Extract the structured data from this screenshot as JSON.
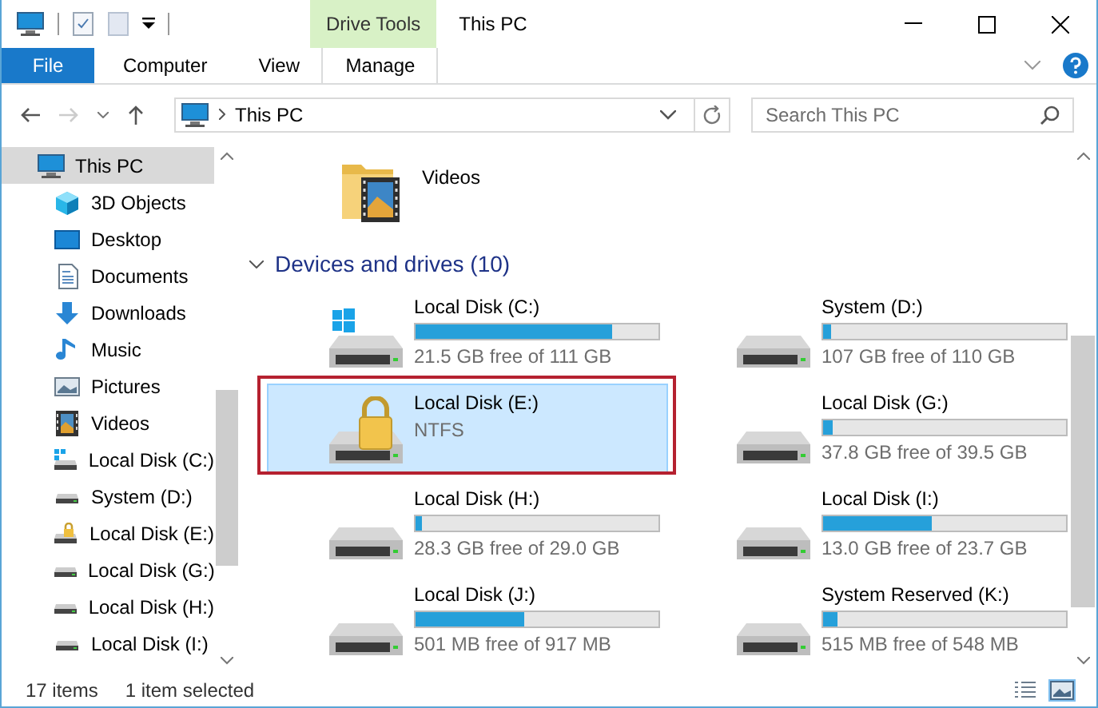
{
  "window": {
    "title": "This PC",
    "context_tab_group": "Drive Tools"
  },
  "ribbon": {
    "tabs": [
      {
        "label": "File",
        "kind": "file",
        "selected": false
      },
      {
        "label": "Computer",
        "kind": "normal",
        "selected": false
      },
      {
        "label": "View",
        "kind": "normal",
        "selected": false
      },
      {
        "label": "Manage",
        "kind": "context",
        "selected": false
      }
    ]
  },
  "address_bar": {
    "path": "This PC",
    "search": {
      "placeholder": "Search This PC"
    }
  },
  "sidebar": {
    "items": [
      {
        "label": "This PC",
        "kind": "pc",
        "selected": true,
        "children": [
          {
            "label": "3D Objects",
            "kind": "objects",
            "selected": false
          },
          {
            "label": "Desktop",
            "kind": "desktop",
            "selected": false
          },
          {
            "label": "Documents",
            "kind": "documents",
            "selected": false
          },
          {
            "label": "Downloads",
            "kind": "downloads",
            "selected": false
          },
          {
            "label": "Music",
            "kind": "music",
            "selected": false
          },
          {
            "label": "Pictures",
            "kind": "pictures",
            "selected": false
          },
          {
            "label": "Videos",
            "kind": "videos",
            "selected": false
          },
          {
            "label": "Local Disk (C:)",
            "kind": "system",
            "selected": false
          },
          {
            "label": "System (D:)",
            "kind": "drive",
            "selected": false
          },
          {
            "label": "Local Disk (E:)",
            "kind": "locked",
            "selected": false
          },
          {
            "label": "Local Disk (G:)",
            "kind": "drive",
            "selected": false
          },
          {
            "label": "Local Disk (H:)",
            "kind": "drive",
            "selected": false
          },
          {
            "label": "Local Disk (I:)",
            "kind": "drive",
            "selected": false
          }
        ]
      }
    ]
  },
  "content": {
    "folders": [
      {
        "label": "Videos",
        "kind": "videos"
      }
    ],
    "group": {
      "label": "Devices and drives (10)"
    },
    "drives": [
      {
        "name": "Local Disk (C:)",
        "kind": "system",
        "level": 0.81,
        "info": "21.5 GB free of 111 GB",
        "selected": false
      },
      {
        "name": "System (D:)",
        "kind": "drive",
        "level": 0.03,
        "info": "107 GB free of 110 GB",
        "selected": false
      },
      {
        "name": "Local Disk (E:)",
        "kind": "locked",
        "info": "NTFS",
        "selected": true,
        "highlighted": true
      },
      {
        "name": "Local Disk (G:)",
        "kind": "drive",
        "level": 0.04,
        "info": "37.8 GB free of 39.5 GB",
        "selected": false
      },
      {
        "name": "Local Disk (H:)",
        "kind": "drive",
        "level": 0.025,
        "info": "28.3 GB free of 29.0 GB",
        "selected": false
      },
      {
        "name": "Local Disk (I:)",
        "kind": "drive",
        "level": 0.45,
        "info": "13.0 GB free of 23.7 GB",
        "selected": false
      },
      {
        "name": "Local Disk (J:)",
        "kind": "drive",
        "level": 0.45,
        "info": "501 MB free of 917 MB",
        "selected": false
      },
      {
        "name": "System Reserved (K:)",
        "kind": "drive",
        "level": 0.06,
        "info": "515 MB free of 548 MB",
        "selected": false
      }
    ]
  },
  "status_bar": {
    "item_count": "17 items",
    "selection": "1 item selected"
  }
}
